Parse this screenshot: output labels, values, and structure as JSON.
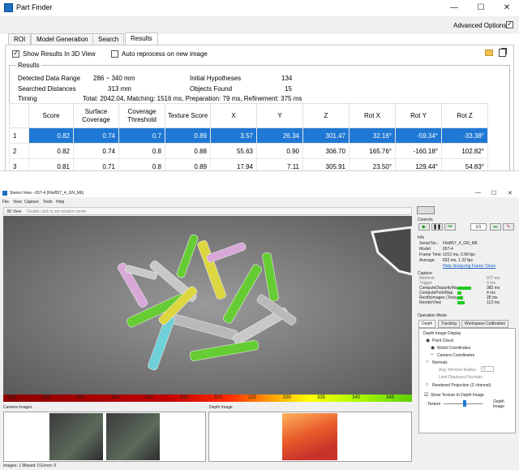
{
  "part_finder": {
    "title": "Part Finder",
    "advanced_options_label": "Advanced Options",
    "advanced_options_checked": true,
    "tabs": [
      {
        "label": "ROI",
        "active": false
      },
      {
        "label": "Model Generation",
        "active": false
      },
      {
        "label": "Search",
        "active": false
      },
      {
        "label": "Results",
        "active": true
      }
    ],
    "show_results_label": "Show Results In 3D View",
    "show_results_checked": true,
    "auto_reprocess_label": "Auto reprocess on new image",
    "auto_reprocess_checked": false,
    "results_group": "Results",
    "stats": {
      "detected_label": "Detected Data Range",
      "detected_value": "286 ~ 340 mm",
      "searched_label": "Searched Distances",
      "searched_value": "313 mm",
      "timing_label": "Timing",
      "timing_value": "Total: 2042.04, Matching: 1516 ms, Preparation: 79 ms, Refinement: 375 ms",
      "hypotheses_label": "Initial Hypotheses",
      "hypotheses_value": "134",
      "objects_label": "Objects Found",
      "objects_value": "15"
    },
    "table": {
      "columns": [
        "Score",
        "Surface Coverage",
        "Coverage Threshold",
        "Texture Score",
        "X",
        "Y",
        "Z",
        "Rot X",
        "Rot Y",
        "Rot Z"
      ],
      "rows": [
        {
          "id": "1",
          "cells": [
            "0.82",
            "0.74",
            "0.7",
            "0.89",
            "3.57",
            "26.34",
            "301.47",
            "32.16°",
            "-59.34°",
            "-33.38°"
          ],
          "selected": true
        },
        {
          "id": "2",
          "cells": [
            "0.82",
            "0.74",
            "0.8",
            "0.88",
            "55.63",
            "0.90",
            "306.70",
            "165.76°",
            "-160.18°",
            "102.82°"
          ],
          "selected": false
        },
        {
          "id": "3",
          "cells": [
            "0.81",
            "0.71",
            "0.8",
            "0.89",
            "17.94",
            "7.11",
            "305.91",
            "23.50°",
            "129.44°",
            "54.83°"
          ],
          "selected": false
        }
      ]
    }
  },
  "stereo_view": {
    "title": "Stereo View - 657-4 (FileB57_4_GN_M6)",
    "menu": [
      "File",
      "View",
      "Capture",
      "Tools",
      "Help"
    ],
    "view_label": "3D View",
    "view_hint": "Double click to set rotation center",
    "colorbar_ticks": [
      "290",
      "295",
      "300",
      "305",
      "310",
      "315",
      "320",
      "325",
      "330",
      "335",
      "340",
      "345"
    ],
    "camera_images_label": "Camera Images",
    "depth_image_label": "Depth Image",
    "status": "Images: 1   Missed: 0   Errors: 0",
    "controls_label": "Controls",
    "frame_counter": "1/1",
    "info": {
      "label": "Info",
      "rows": [
        {
          "k": "Serial No.:",
          "v": "FileB57_4_GN_M6"
        },
        {
          "k": "Model:",
          "v": "657-4"
        },
        {
          "k": "Frame Time:",
          "v": "1012 ms, 0.99 fps"
        },
        {
          "k": "Average:",
          "v": "822 ms, 1.22 fps"
        }
      ],
      "link": "Help: Analyzing Frame Times"
    },
    "capture": {
      "label": "Capture",
      "rows": [
        {
          "k": "Retrieve",
          "v": "977 ms",
          "bar": 0
        },
        {
          "k": "Trigger",
          "v": "0 ms",
          "bar": 0
        },
        {
          "k": "ComputeDisparityMap",
          "v": "382 ms",
          "bar": 0.9
        },
        {
          "k": "ComputePointMap",
          "v": "4 ms",
          "bar": 0.25
        },
        {
          "k": "RectifyImages (Texture)",
          "v": "28 ms",
          "bar": 0.35
        },
        {
          "k": "RenderView",
          "v": "112 ms",
          "bar": 0.45
        }
      ]
    },
    "operation_mode_label": "Operation Mode",
    "mode_tabs": [
      "Depth",
      "Tracking",
      "Workspace Calibration"
    ],
    "depth_display_label": "Depth Image Display",
    "point_cloud_label": "Point Cloud",
    "world_coords_label": "World Coordinates",
    "camera_coords_label": "Camera Coordinates",
    "normals_label": "Normals",
    "avg_window_label": "Avg. Window Radius",
    "avg_window_value": "5",
    "limit_normals_label": "Limit Displayed Normals",
    "rendered_projection_label": "Rendered Projection (Z channel)",
    "show_texture_label": "Show Texture In Depth Image",
    "texture_label": "Texture",
    "depth_image_slider_label": "Depth Image",
    "accent_green": "#23c823",
    "selection_blue": "#1e78d4"
  }
}
